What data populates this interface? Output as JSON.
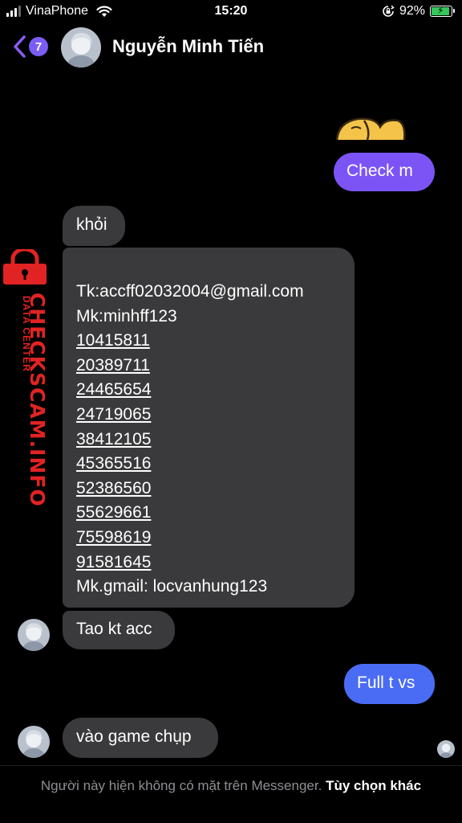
{
  "status_bar": {
    "carrier": "VinaPhone",
    "time": "15:20",
    "battery_percent": "92%",
    "battery_level": 0.92,
    "icons": [
      "signal-icon",
      "wifi-icon",
      "orientation-lock-icon",
      "battery-charging-icon"
    ]
  },
  "header": {
    "back_badge": "7",
    "contact_name": "Nguyễn Minh Tiến"
  },
  "messages": {
    "check": "Check m",
    "khoi": "khỏi",
    "list": {
      "tk": "Tk:accff02032004@gmail.com",
      "mk": "Mk:minhff123",
      "ids": [
        "10415811",
        "20389711",
        "24465654",
        "24719065",
        "38412105",
        "45365516",
        "52386560",
        "55629661",
        "75598619",
        "91581645"
      ],
      "mk_gmail": "Mk.gmail: locvanhung123"
    },
    "tao": "Tao kt acc",
    "full": "Full t vs",
    "vao": "vào game chụp"
  },
  "watermark": {
    "main": "CHECKSCAM.INFO",
    "sub": "DATA CENTER"
  },
  "footer": {
    "text": "Người này hiện không có mặt trên Messenger.",
    "more": "Tùy chọn khác"
  },
  "colors": {
    "accent_purple": "#7c54f6",
    "accent_blue": "#4a6cf5",
    "incoming_bubble": "#3a3a3c",
    "watermark_red": "#e12323"
  }
}
